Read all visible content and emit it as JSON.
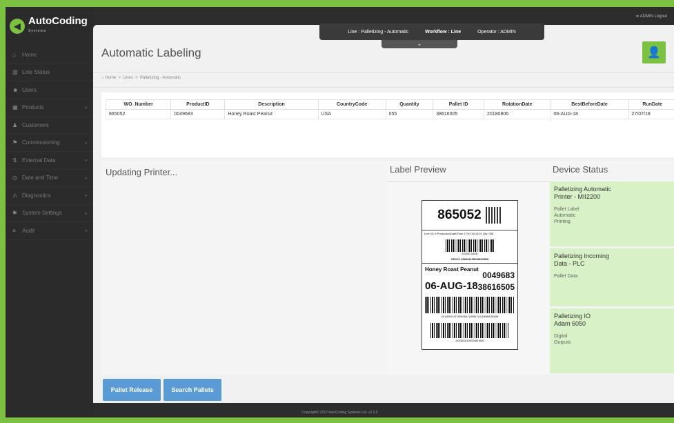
{
  "logo": {
    "name": "AutoCoding",
    "sub": "Systems"
  },
  "topbar": {
    "admin_logout": "ADMIN Logout"
  },
  "sidebar": {
    "items": [
      {
        "label": "Home",
        "icon": "home-icon",
        "glyph": "⌂",
        "arrow": ""
      },
      {
        "label": "Line Status",
        "icon": "chart-icon",
        "glyph": "▥",
        "arrow": ""
      },
      {
        "label": "Users",
        "icon": "users-icon",
        "glyph": "☻",
        "arrow": ""
      },
      {
        "label": "Products",
        "icon": "grid-icon",
        "glyph": "▦",
        "arrow": "◂"
      },
      {
        "label": "Customers",
        "icon": "customers-icon",
        "glyph": "♟",
        "arrow": ""
      },
      {
        "label": "Commissioning",
        "icon": "flag-icon",
        "glyph": "⚑",
        "arrow": "◂"
      },
      {
        "label": "External Data",
        "icon": "data-icon",
        "glyph": "⇅",
        "arrow": "◂"
      },
      {
        "label": "Date and Time",
        "icon": "clock-icon",
        "glyph": "◷",
        "arrow": "◂"
      },
      {
        "label": "Diagnostics",
        "icon": "warning-icon",
        "glyph": "⚠",
        "arrow": "◂"
      },
      {
        "label": "System Settings",
        "icon": "settings-icon",
        "glyph": "✱",
        "arrow": "◂"
      },
      {
        "label": "Audit",
        "icon": "list-icon",
        "glyph": "≡",
        "arrow": "◂"
      }
    ]
  },
  "context": {
    "line_label": "Line : Palletizing - Automatic",
    "workflow_label": "Workflow : Line",
    "operator_label": "Operator : ADMIN"
  },
  "page": {
    "title": "Automatic Labeling"
  },
  "breadcrumb": {
    "home": "Home",
    "lines": "Lines",
    "current": "Palletizing - Automatic"
  },
  "table": {
    "headers": [
      "WO_Number",
      "ProductID",
      "Description",
      "CountryCode",
      "Quantity",
      "Pallet ID",
      "RotationDate",
      "BestBeforeDate",
      "RunDate"
    ],
    "row": [
      "865052",
      "0049683",
      "Honey Roast Peanut",
      "USA",
      "055",
      "38616505",
      "20180806",
      "06-AUG-18",
      "27/07/18"
    ]
  },
  "updating": {
    "title": "Updating Printer..."
  },
  "preview": {
    "title": "Label Preview",
    "label": {
      "big_number": "865052",
      "meta_line": "Line 03: 6   ProductionDate/Time 27/07/18 16:57   Qty: 055",
      "sscc_top": "(00)050-03000",
      "sscc_line": "SSCC# 350001155038616505",
      "product_name": "Honey Roast Peanut",
      "product_id": "0049683",
      "best_before": "06-AUG-18",
      "pallet_id": "38616505",
      "barcode_line1": "(01)050001137350045(17)180817(11)180806(30)055",
      "barcode_line2": "(00)350001155038616505"
    }
  },
  "device": {
    "title": "Device Status",
    "cards": [
      {
        "name": "Palletizing Automatic\nPrinter -  MII2200",
        "desc": "Pallet Label\nAutomatic\nPrinting"
      },
      {
        "name": "Palletizing Incoming\nData - PLC",
        "desc": "Pallet Data"
      },
      {
        "name": "Palletizing IO\nAdam 6050",
        "desc": "Digital\nOutputs"
      }
    ]
  },
  "actions": {
    "pallet_release": "Pallet Release",
    "search_pallets": "Search Pallets"
  },
  "footer": {
    "copyright": "Copyright© 2017 AutoCoding Systems Ltd. v2.2.5"
  },
  "colors": {
    "accent": "#7dc142",
    "button": "#5b9bd5",
    "sidebar": "#2b2b2b"
  }
}
